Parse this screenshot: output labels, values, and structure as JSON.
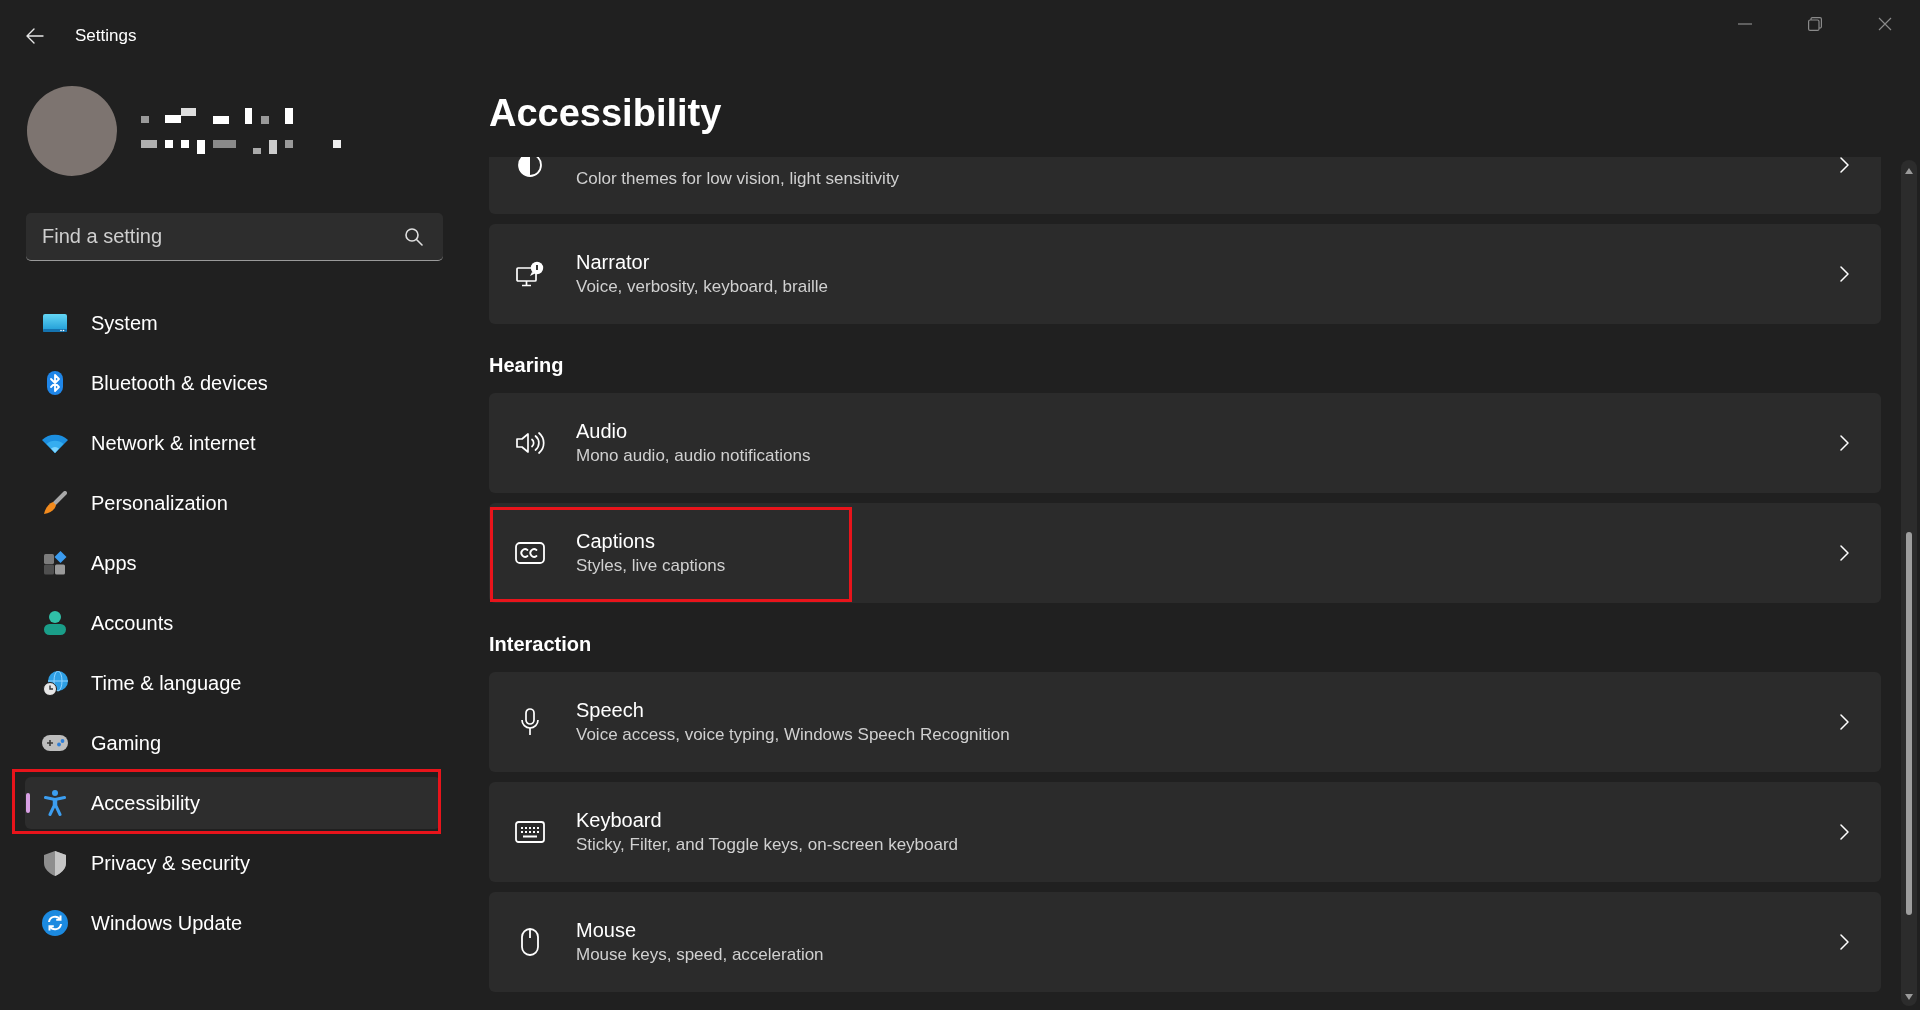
{
  "window": {
    "title": "Settings"
  },
  "search": {
    "placeholder": "Find a setting"
  },
  "sidebar": {
    "items": [
      {
        "label": "System",
        "selected": false,
        "highlighted": false
      },
      {
        "label": "Bluetooth & devices",
        "selected": false,
        "highlighted": false
      },
      {
        "label": "Network & internet",
        "selected": false,
        "highlighted": false
      },
      {
        "label": "Personalization",
        "selected": false,
        "highlighted": false
      },
      {
        "label": "Apps",
        "selected": false,
        "highlighted": false
      },
      {
        "label": "Accounts",
        "selected": false,
        "highlighted": false
      },
      {
        "label": "Time & language",
        "selected": false,
        "highlighted": false
      },
      {
        "label": "Gaming",
        "selected": false,
        "highlighted": false
      },
      {
        "label": "Accessibility",
        "selected": true,
        "highlighted": true
      },
      {
        "label": "Privacy & security",
        "selected": false,
        "highlighted": false
      },
      {
        "label": "Windows Update",
        "selected": false,
        "highlighted": false
      }
    ]
  },
  "page": {
    "title": "Accessibility"
  },
  "sections": [
    {
      "cards": [
        {
          "description": "Color themes for low vision, light sensitivity",
          "highlighted": false
        },
        {
          "title": "Narrator",
          "description": "Voice, verbosity, keyboard, braille",
          "highlighted": false
        }
      ]
    },
    {
      "heading": "Hearing",
      "cards": [
        {
          "title": "Audio",
          "description": "Mono audio, audio notifications",
          "highlighted": false
        },
        {
          "title": "Captions",
          "description": "Styles, live captions",
          "highlighted": true
        }
      ]
    },
    {
      "heading": "Interaction",
      "cards": [
        {
          "title": "Speech",
          "description": "Voice access, voice typing, Windows Speech Recognition",
          "highlighted": false
        },
        {
          "title": "Keyboard",
          "description": "Sticky, Filter, and Toggle keys, on-screen keyboard",
          "highlighted": false
        },
        {
          "title": "Mouse",
          "description": "Mouse keys, speed, acceleration",
          "highlighted": false
        }
      ]
    }
  ]
}
